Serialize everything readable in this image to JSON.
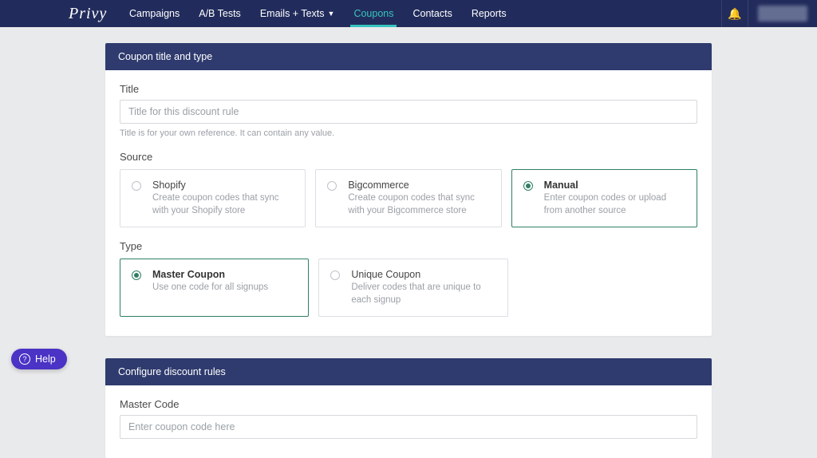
{
  "brand": "Privy",
  "nav": {
    "campaigns": "Campaigns",
    "ab_tests": "A/B Tests",
    "emails_texts": "Emails + Texts",
    "coupons": "Coupons",
    "contacts": "Contacts",
    "reports": "Reports"
  },
  "panel1": {
    "header": "Coupon title and type",
    "title_label": "Title",
    "title_placeholder": "Title for this discount rule",
    "title_help": "Title is for your own reference. It can contain any value.",
    "source_label": "Source",
    "source": {
      "shopify": {
        "title": "Shopify",
        "desc": "Create coupon codes that sync with your Shopify store"
      },
      "bigcommerce": {
        "title": "Bigcommerce",
        "desc": "Create coupon codes that sync with your Bigcommerce store"
      },
      "manual": {
        "title": "Manual",
        "desc": "Enter coupon codes or upload from another source"
      }
    },
    "type_label": "Type",
    "type": {
      "master": {
        "title": "Master Coupon",
        "desc": "Use one code for all signups"
      },
      "unique": {
        "title": "Unique Coupon",
        "desc": "Deliver codes that are unique to each signup"
      }
    }
  },
  "panel2": {
    "header": "Configure discount rules",
    "master_code_label": "Master Code",
    "master_code_placeholder": "Enter coupon code here"
  },
  "help": "Help"
}
